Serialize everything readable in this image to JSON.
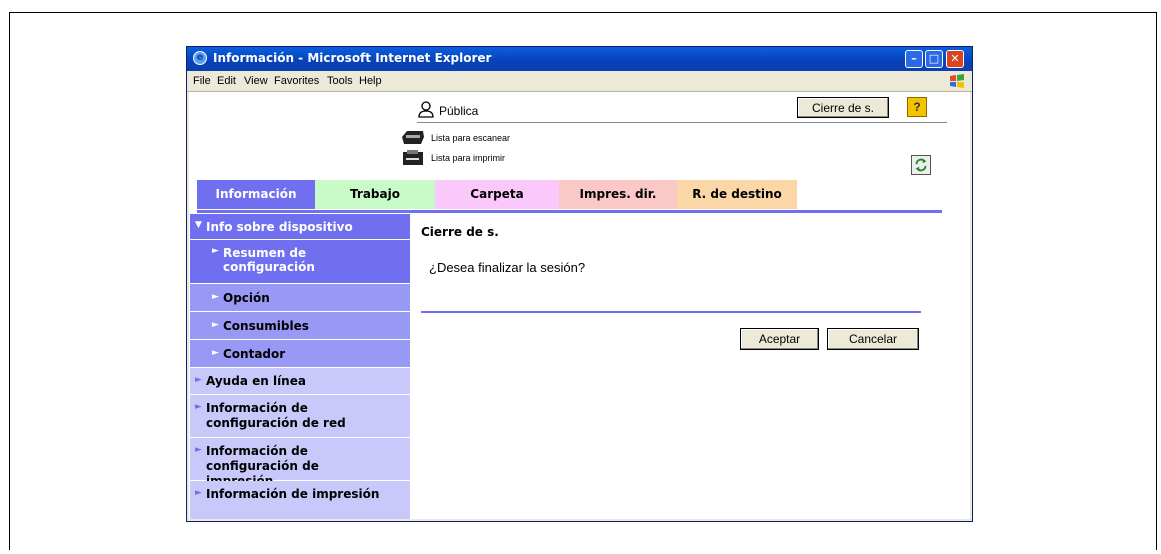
{
  "window": {
    "title": "Información - Microsoft Internet Explorer",
    "min_glyph": "–",
    "max_glyph": "□",
    "close_glyph": "✕"
  },
  "menu": [
    "File",
    "Edit",
    "View",
    "Favorites",
    "Tools",
    "Help"
  ],
  "header": {
    "user_label": "Pública",
    "logout_label": "Cierre de s.",
    "help_glyph": "?",
    "status_scan": "Lista para escanear",
    "status_print": "Lista para imprimir"
  },
  "tabs": [
    {
      "label": "Información",
      "color": "#6f6ff0",
      "text_color": "#ffffff"
    },
    {
      "label": "Trabajo",
      "color": "#c8fbc8",
      "text_color": "#000000"
    },
    {
      "label": "Carpeta",
      "color": "#fbc8fb",
      "text_color": "#000000"
    },
    {
      "label": "Impres. dir.",
      "color": "#fbc8c8",
      "text_color": "#000000"
    },
    {
      "label": "R. de destino",
      "color": "#fbd7a8",
      "text_color": "#000000"
    }
  ],
  "sidebar": {
    "items": [
      {
        "label": "Info sobre dispositivo",
        "arrow": "▼"
      },
      {
        "label": "Resumen de configuración",
        "arrow": "►"
      },
      {
        "label": "Opción",
        "arrow": "►"
      },
      {
        "label": "Consumibles",
        "arrow": "►"
      },
      {
        "label": "Contador",
        "arrow": "►"
      },
      {
        "label": "Ayuda en línea",
        "arrow": "►"
      },
      {
        "label": "Información de configuración de red",
        "arrow": "►"
      },
      {
        "label": "Información de configuración de impresión",
        "arrow": "►"
      },
      {
        "label": "Información de impresión",
        "arrow": "►"
      }
    ]
  },
  "main": {
    "title": "Cierre de s.",
    "question": "¿Desea finalizar la sesión?",
    "ok_label": "Aceptar",
    "cancel_label": "Cancelar"
  }
}
